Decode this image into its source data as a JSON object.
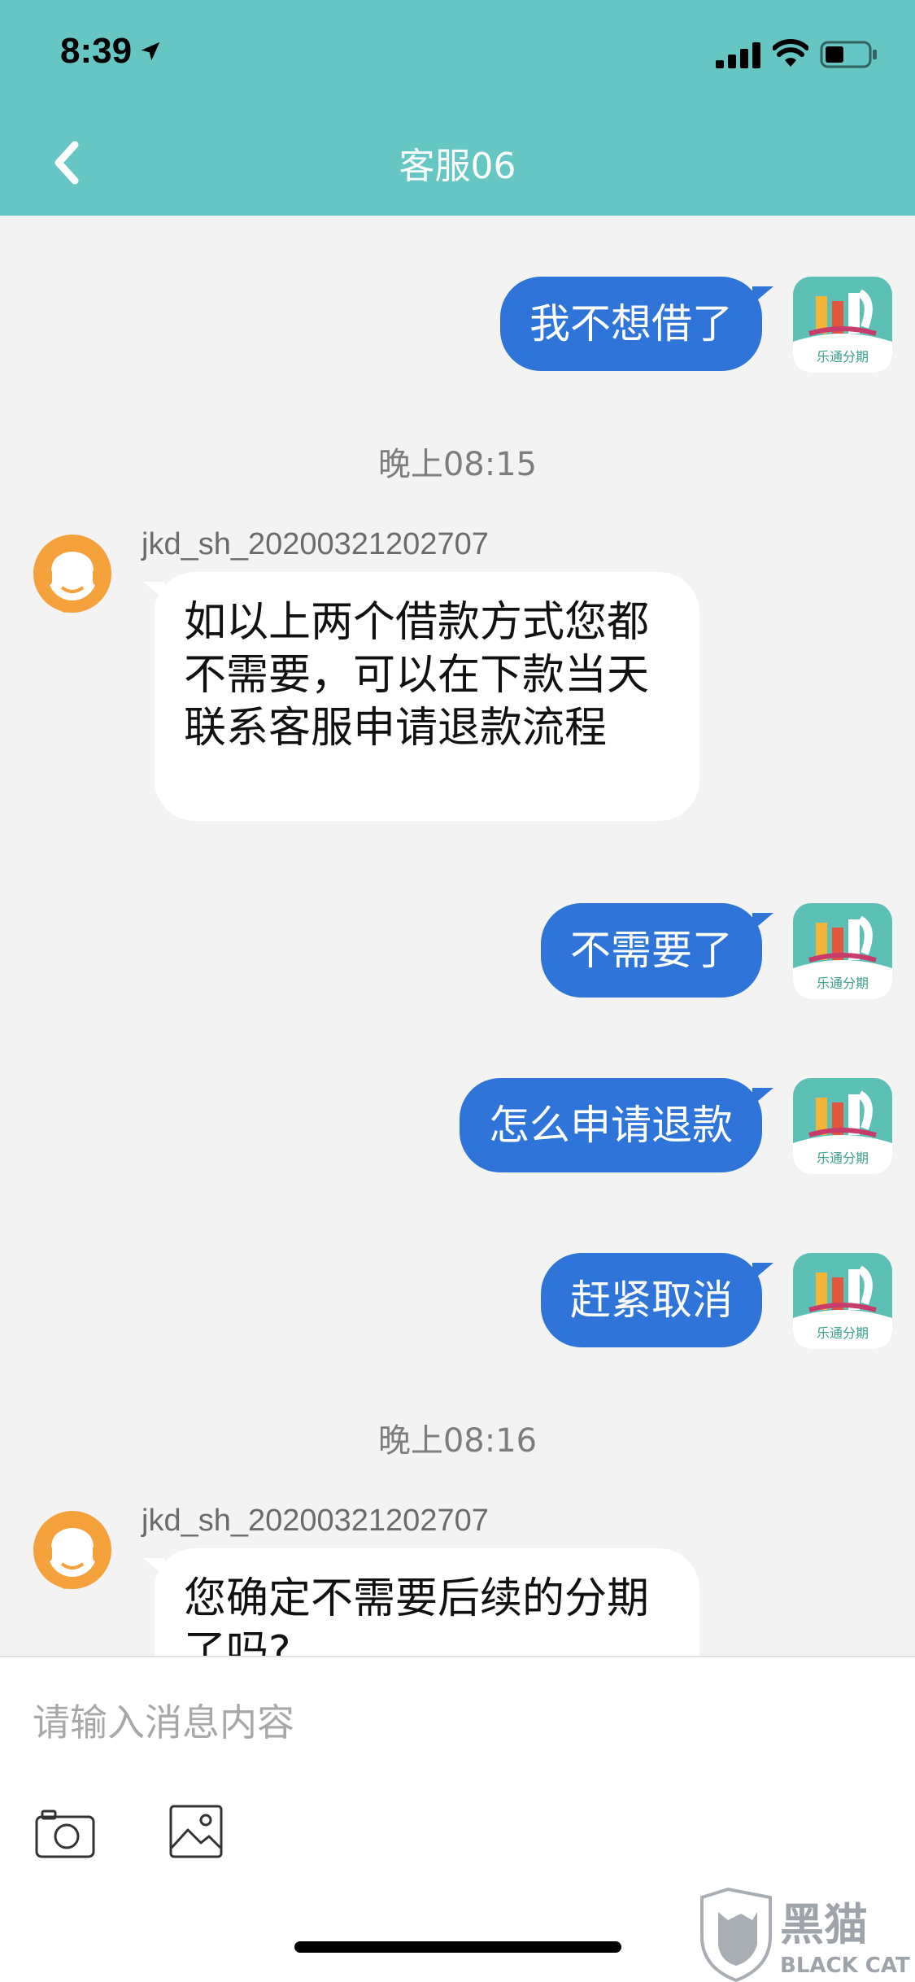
{
  "status_bar": {
    "time": "8:39"
  },
  "nav": {
    "title": "客服06"
  },
  "messages": {
    "m1": "我不想借了",
    "ts1": "晚上08:15",
    "agent1_name": "jkd_sh_20200321202707",
    "agent1_text": "如以上两个借款方式您都不需要，可以在下款当天联系客服申请退款流程",
    "m2": "不需要了",
    "m3": "怎么申请退款",
    "m4": "赶紧取消",
    "ts2": "晚上08:16",
    "agent2_name": "jkd_sh_20200321202707",
    "agent2_text": "您确定不需要后续的分期了吗?"
  },
  "app_icon": {
    "label": "乐通分期"
  },
  "composer": {
    "placeholder": "请输入消息内容"
  },
  "watermark": {
    "cn": "黑猫",
    "en": "BLACK CAT"
  },
  "colors": {
    "header": "#66c6c3",
    "outgoing_bubble": "#2f74d8",
    "incoming_bubble": "#ffffff",
    "background": "#f3f3f4"
  }
}
